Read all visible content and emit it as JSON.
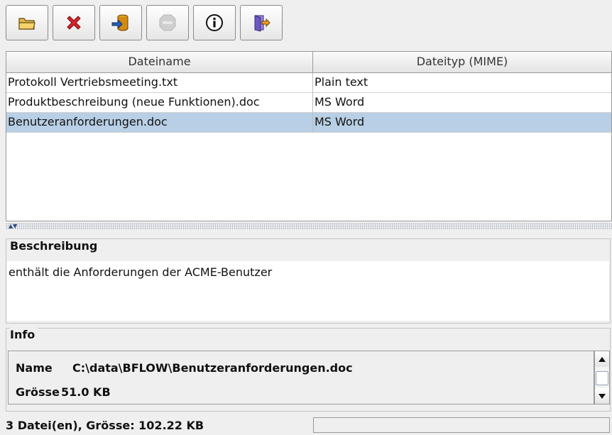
{
  "toolbar": {
    "buttons": [
      {
        "icon": "folder-open-icon",
        "enabled": true
      },
      {
        "icon": "delete-x-icon",
        "enabled": true
      },
      {
        "icon": "import-database-icon",
        "enabled": true
      },
      {
        "icon": "stop-icon",
        "enabled": false
      },
      {
        "icon": "info-icon",
        "enabled": true
      },
      {
        "icon": "exit-door-icon",
        "enabled": true
      }
    ]
  },
  "table": {
    "columns": [
      "Dateiname",
      "Dateityp (MIME)"
    ],
    "rows": [
      {
        "name": "Protokoll Vertriebsmeeting.txt",
        "type": "Plain text",
        "selected": false
      },
      {
        "name": "Produktbeschreibung (neue Funktionen).doc",
        "type": "MS Word",
        "selected": false
      },
      {
        "name": "Benutzeranforderungen.doc",
        "type": "MS Word",
        "selected": true
      }
    ]
  },
  "description": {
    "title": "Beschreibung",
    "text": "enthält die Anforderungen der ACME-Benutzer"
  },
  "info": {
    "title": "Info",
    "name_label": "Name",
    "name_value": "C:\\data\\BFLOW\\Benutzeranforderungen.doc",
    "size_label": "Grösse",
    "size_value": "51.0 KB"
  },
  "status": {
    "text": "3 Datei(en), Grösse: 102.22 KB",
    "field": ""
  },
  "colors": {
    "selection": "#b8cfe5",
    "background": "#efefef"
  }
}
